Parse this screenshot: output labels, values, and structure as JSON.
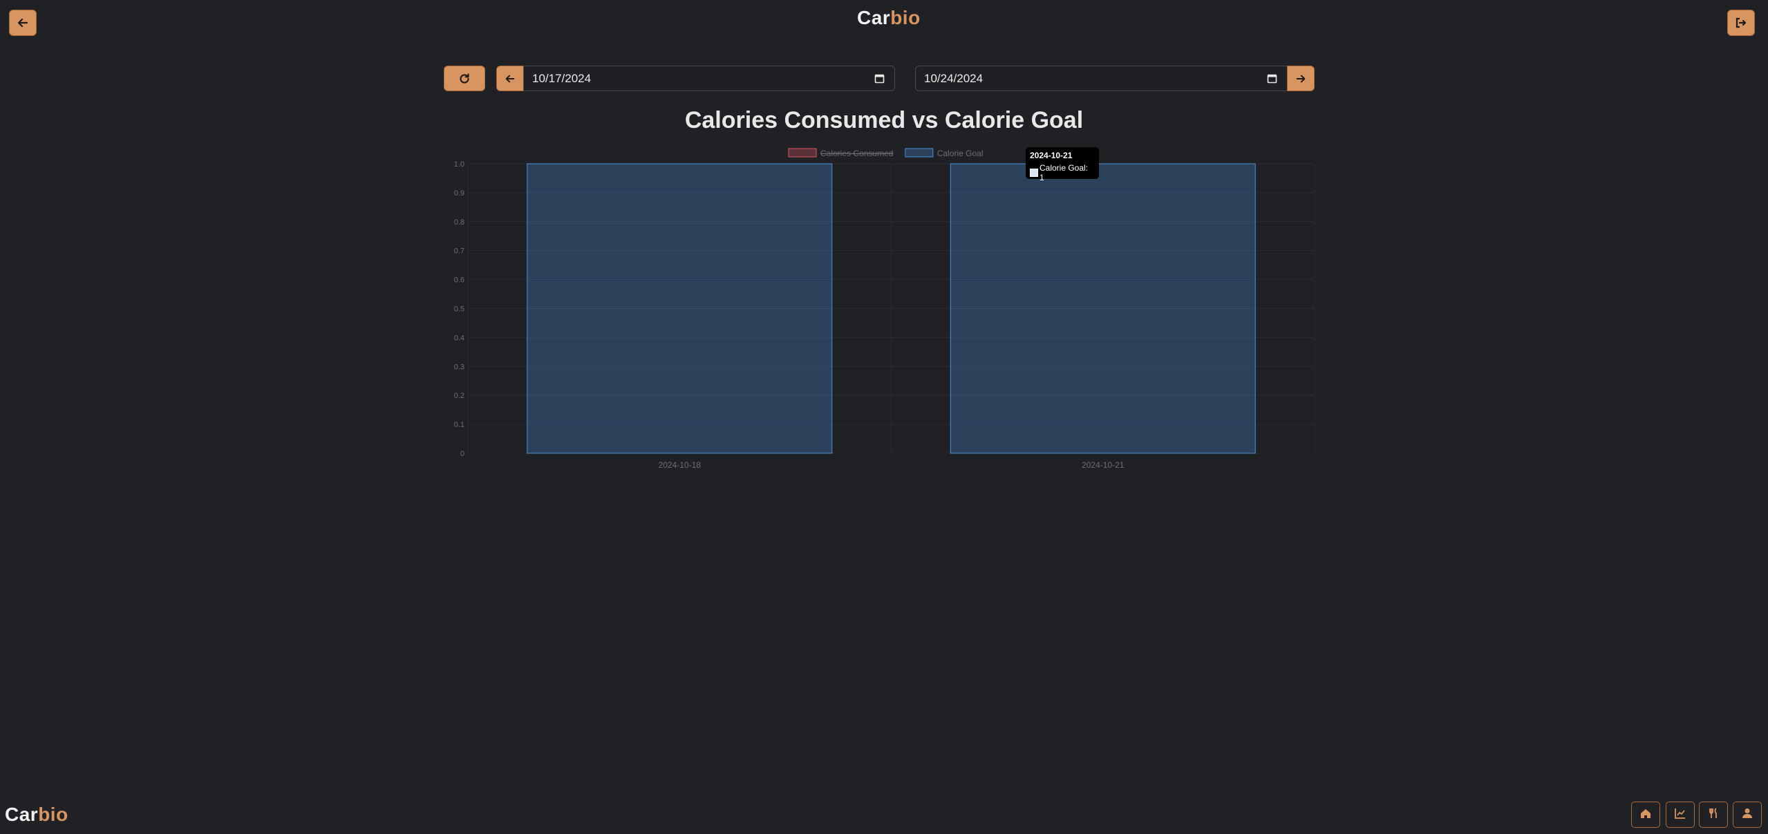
{
  "app": {
    "logo_part1": "Car",
    "logo_part2": "bio"
  },
  "header": {
    "back_icon": "arrow-left-icon",
    "logout_icon": "logout-icon"
  },
  "date_range": {
    "start_date": "10/17/2024",
    "end_date": "10/24/2024",
    "refresh_icon": "refresh-icon",
    "prev_icon": "arrow-left-icon",
    "next_icon": "arrow-right-icon"
  },
  "tooltip": {
    "title": "2024-10-21",
    "label": "Calorie Goal: 1"
  },
  "bottom_nav": {
    "items": [
      {
        "icon": "home-icon"
      },
      {
        "icon": "chart-icon"
      },
      {
        "icon": "utensils-icon"
      },
      {
        "icon": "user-icon"
      }
    ]
  },
  "colors": {
    "accent": "#d9955f",
    "background": "#202124",
    "consumed": "#d9535f",
    "goal": "#4a90d9"
  },
  "chart_data": {
    "type": "bar",
    "title": "Calories Consumed vs Calorie Goal",
    "categories": [
      "2024-10-18",
      "2024-10-21"
    ],
    "series": [
      {
        "name": "Calories Consumed",
        "values": [
          0,
          0
        ],
        "hidden": true
      },
      {
        "name": "Calorie Goal",
        "values": [
          1,
          1
        ]
      }
    ],
    "ylim": [
      0,
      1
    ],
    "yticks": [
      "0",
      "0.1",
      "0.2",
      "0.3",
      "0.4",
      "0.5",
      "0.6",
      "0.7",
      "0.8",
      "0.9",
      "1.0"
    ],
    "legend_position": "top",
    "grid": true
  }
}
